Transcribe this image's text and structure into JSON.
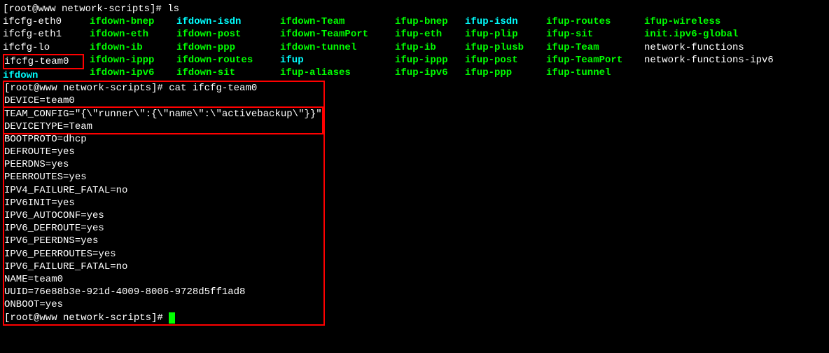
{
  "prompt1": "[root@www network-scripts]# ls",
  "ls_columns": [
    {
      "width": "col0",
      "items": [
        {
          "text": "ifcfg-eth0",
          "cls": "white"
        },
        {
          "text": "ifcfg-eth1",
          "cls": "white"
        },
        {
          "text": "ifcfg-lo",
          "cls": "white"
        },
        {
          "text": "ifcfg-team0",
          "cls": "white",
          "boxed": true
        },
        {
          "text": "ifdown",
          "cls": "bold-cyan"
        }
      ]
    },
    {
      "width": "col1",
      "items": [
        {
          "text": "ifdown-bnep",
          "cls": "bold-green"
        },
        {
          "text": "ifdown-eth",
          "cls": "bold-green"
        },
        {
          "text": "ifdown-ib",
          "cls": "bold-green"
        },
        {
          "text": "ifdown-ippp",
          "cls": "bold-green"
        },
        {
          "text": "ifdown-ipv6",
          "cls": "bold-green"
        }
      ]
    },
    {
      "width": "col2",
      "items": [
        {
          "text": "ifdown-isdn",
          "cls": "bold-cyan"
        },
        {
          "text": "ifdown-post",
          "cls": "bold-green"
        },
        {
          "text": "ifdown-ppp",
          "cls": "bold-green"
        },
        {
          "text": "ifdown-routes",
          "cls": "bold-green"
        },
        {
          "text": "ifdown-sit",
          "cls": "bold-green"
        }
      ]
    },
    {
      "width": "col3",
      "items": [
        {
          "text": "ifdown-Team",
          "cls": "bold-green"
        },
        {
          "text": "ifdown-TeamPort",
          "cls": "bold-green"
        },
        {
          "text": "ifdown-tunnel",
          "cls": "bold-green"
        },
        {
          "text": "ifup",
          "cls": "bold-cyan"
        },
        {
          "text": "ifup-aliases",
          "cls": "bold-green"
        }
      ]
    },
    {
      "width": "col4",
      "items": [
        {
          "text": "ifup-bnep",
          "cls": "bold-green"
        },
        {
          "text": "ifup-eth",
          "cls": "bold-green"
        },
        {
          "text": "ifup-ib",
          "cls": "bold-green"
        },
        {
          "text": "ifup-ippp",
          "cls": "bold-green"
        },
        {
          "text": "ifup-ipv6",
          "cls": "bold-green"
        }
      ]
    },
    {
      "width": "col5",
      "items": [
        {
          "text": "ifup-isdn",
          "cls": "bold-cyan"
        },
        {
          "text": "ifup-plip",
          "cls": "bold-green"
        },
        {
          "text": "ifup-plusb",
          "cls": "bold-green"
        },
        {
          "text": "ifup-post",
          "cls": "bold-green"
        },
        {
          "text": "ifup-ppp",
          "cls": "bold-green"
        }
      ]
    },
    {
      "width": "col6",
      "items": [
        {
          "text": "ifup-routes",
          "cls": "bold-green"
        },
        {
          "text": "ifup-sit",
          "cls": "bold-green"
        },
        {
          "text": "ifup-Team",
          "cls": "bold-green"
        },
        {
          "text": "ifup-TeamPort",
          "cls": "bold-green"
        },
        {
          "text": "ifup-tunnel",
          "cls": "bold-green"
        }
      ]
    },
    {
      "width": "col7",
      "items": [
        {
          "text": "ifup-wireless",
          "cls": "bold-green"
        },
        {
          "text": "init.ipv6-global",
          "cls": "bold-green"
        },
        {
          "text": "network-functions",
          "cls": "white"
        },
        {
          "text": "network-functions-ipv6",
          "cls": "white"
        },
        {
          "text": "",
          "cls": "white"
        }
      ]
    }
  ],
  "prompt2": "[root@www network-scripts]# cat ifcfg-team0",
  "config_top": [
    "DEVICE=team0"
  ],
  "config_boxed": [
    "TEAM_CONFIG=\"{\\\"runner\\\":{\\\"name\\\":\\\"activebackup\\\"}}\"",
    "DEVICETYPE=Team"
  ],
  "config_rest": [
    "BOOTPROTO=dhcp",
    "DEFROUTE=yes",
    "PEERDNS=yes",
    "PEERROUTES=yes",
    "IPV4_FAILURE_FATAL=no",
    "IPV6INIT=yes",
    "IPV6_AUTOCONF=yes",
    "IPV6_DEFROUTE=yes",
    "IPV6_PEERDNS=yes",
    "IPV6_PEERROUTES=yes",
    "IPV6_FAILURE_FATAL=no",
    "NAME=team0",
    "UUID=76e88b3e-921d-4009-8006-9728d5ff1ad8",
    "ONBOOT=yes"
  ],
  "prompt3": "[root@www network-scripts]# "
}
